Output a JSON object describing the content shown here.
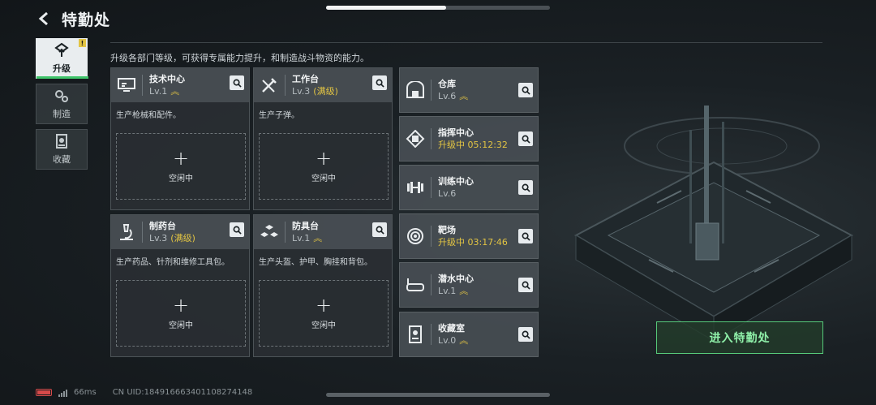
{
  "header": {
    "title": "特勤处"
  },
  "description": "升级各部门等级，可获得专属能力提升，和制造战斗物资的能力。",
  "sidenav": {
    "items": [
      {
        "label": "升级",
        "alert": "!"
      },
      {
        "label": "制造"
      },
      {
        "label": "收藏"
      }
    ]
  },
  "bigcards": [
    {
      "name": "技术中心",
      "level": "Lv.1",
      "max": "",
      "desc": "生产枪械和配件。",
      "slot_status": "空闲中",
      "slot_plus": "+"
    },
    {
      "name": "工作台",
      "level": "Lv.3",
      "max": "(满级)",
      "desc": "生产子弹。",
      "slot_status": "空闲中",
      "slot_plus": "+"
    },
    {
      "name": "制药台",
      "level": "Lv.3",
      "max": "(满级)",
      "desc": "生产药品、针剂和维修工具包。",
      "slot_status": "空闲中",
      "slot_plus": "+"
    },
    {
      "name": "防具台",
      "level": "Lv.1",
      "max": "",
      "desc": "生产头盔、护甲、胸挂和背包。",
      "slot_status": "空闲中",
      "slot_plus": "+"
    }
  ],
  "smallcards": [
    {
      "name": "仓库",
      "level": "Lv.6"
    },
    {
      "name": "指挥中心",
      "timer": "升级中 05:12:32"
    },
    {
      "name": "训练中心",
      "level": "Lv.6"
    },
    {
      "name": "靶场",
      "timer": "升级中 03:17:46"
    },
    {
      "name": "潜水中心",
      "level": "Lv.1"
    },
    {
      "name": "收藏室",
      "level": "Lv.0"
    }
  ],
  "enter_button": "进入特勤处",
  "status": {
    "ping": "66ms",
    "uid": "CN UID:184916663401108274148"
  },
  "colors": {
    "accent_green": "#3fc46a",
    "accent_yellow": "#e2c443",
    "alert_red": "#d64a4a"
  }
}
